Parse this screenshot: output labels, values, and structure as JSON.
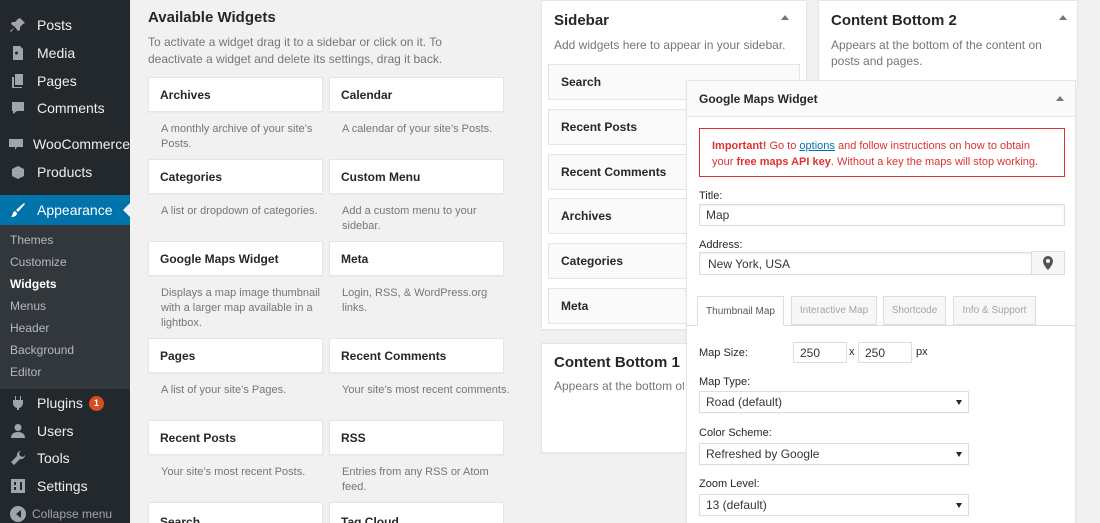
{
  "admin_menu": {
    "items": [
      {
        "label": "Posts",
        "icon": "pin-icon"
      },
      {
        "label": "Media",
        "icon": "media-icon"
      },
      {
        "label": "Pages",
        "icon": "pages-icon"
      },
      {
        "label": "Comments",
        "icon": "comments-icon"
      },
      {
        "label": "WooCommerce",
        "icon": "woocommerce-icon"
      },
      {
        "label": "Products",
        "icon": "products-icon"
      },
      {
        "label": "Appearance",
        "icon": "brush-icon"
      },
      {
        "label": "Plugins",
        "icon": "plug-icon",
        "badge": "1"
      },
      {
        "label": "Users",
        "icon": "user-icon"
      },
      {
        "label": "Tools",
        "icon": "wrench-icon"
      },
      {
        "label": "Settings",
        "icon": "settings-icon"
      }
    ],
    "submenu": [
      "Themes",
      "Customize",
      "Widgets",
      "Menus",
      "Header",
      "Background",
      "Editor"
    ],
    "collapse": "Collapse menu"
  },
  "available": {
    "title": "Available Widgets",
    "description": "To activate a widget drag it to a sidebar or click on it. To deactivate a widget and delete its settings, drag it back.",
    "widgets": [
      {
        "name": "Archives",
        "desc": "A monthly archive of your site’s Posts."
      },
      {
        "name": "Calendar",
        "desc": "A calendar of your site’s Posts."
      },
      {
        "name": "Categories",
        "desc": "A list or dropdown of categories."
      },
      {
        "name": "Custom Menu",
        "desc": "Add a custom menu to your sidebar."
      },
      {
        "name": "Google Maps Widget",
        "desc": "Displays a map image thumbnail with a larger map available in a lightbox."
      },
      {
        "name": "Meta",
        "desc": "Login, RSS, & WordPress.org links."
      },
      {
        "name": "Pages",
        "desc": "A list of your site’s Pages."
      },
      {
        "name": "Recent Comments",
        "desc": "Your site’s most recent comments."
      },
      {
        "name": "Recent Posts",
        "desc": "Your site’s most recent Posts."
      },
      {
        "name": "RSS",
        "desc": "Entries from any RSS or Atom feed."
      },
      {
        "name": "Search",
        "desc": ""
      },
      {
        "name": "Tag Cloud",
        "desc": ""
      }
    ]
  },
  "sidebar": {
    "title": "Sidebar",
    "description": "Add widgets here to appear in your sidebar.",
    "widgets": [
      "Search",
      "Recent Posts",
      "Recent Comments",
      "Archives",
      "Categories",
      "Meta"
    ]
  },
  "content_bottom_1": {
    "title": "Content Bottom 1",
    "description": "Appears at the bottom of the content on posts and pages."
  },
  "content_bottom_2": {
    "title": "Content Bottom 2",
    "description": "Appears at the bottom of the content on posts and pages."
  },
  "gmw": {
    "title": "Google Maps Widget",
    "notice": {
      "important": "Important!",
      "text1": " Go to ",
      "link": "options",
      "text2": " and follow instructions on how to obtain your ",
      "bold": "free maps API key",
      "text3": ". Without a key the maps will stop working."
    },
    "title_label": "Title:",
    "title_value": "Map",
    "address_label": "Address:",
    "address_value": "New York, USA",
    "tabs": [
      "Thumbnail Map",
      "Interactive Map",
      "Shortcode",
      "Info & Support"
    ],
    "map_size_label": "Map Size:",
    "width": "250",
    "x": "x",
    "height": "250",
    "px": "px",
    "map_type_label": "Map Type:",
    "map_type": "Road (default)",
    "color_scheme_label": "Color Scheme:",
    "color_scheme": "Refreshed by Google",
    "zoom_label": "Zoom Level:",
    "zoom": "13 (default)"
  }
}
